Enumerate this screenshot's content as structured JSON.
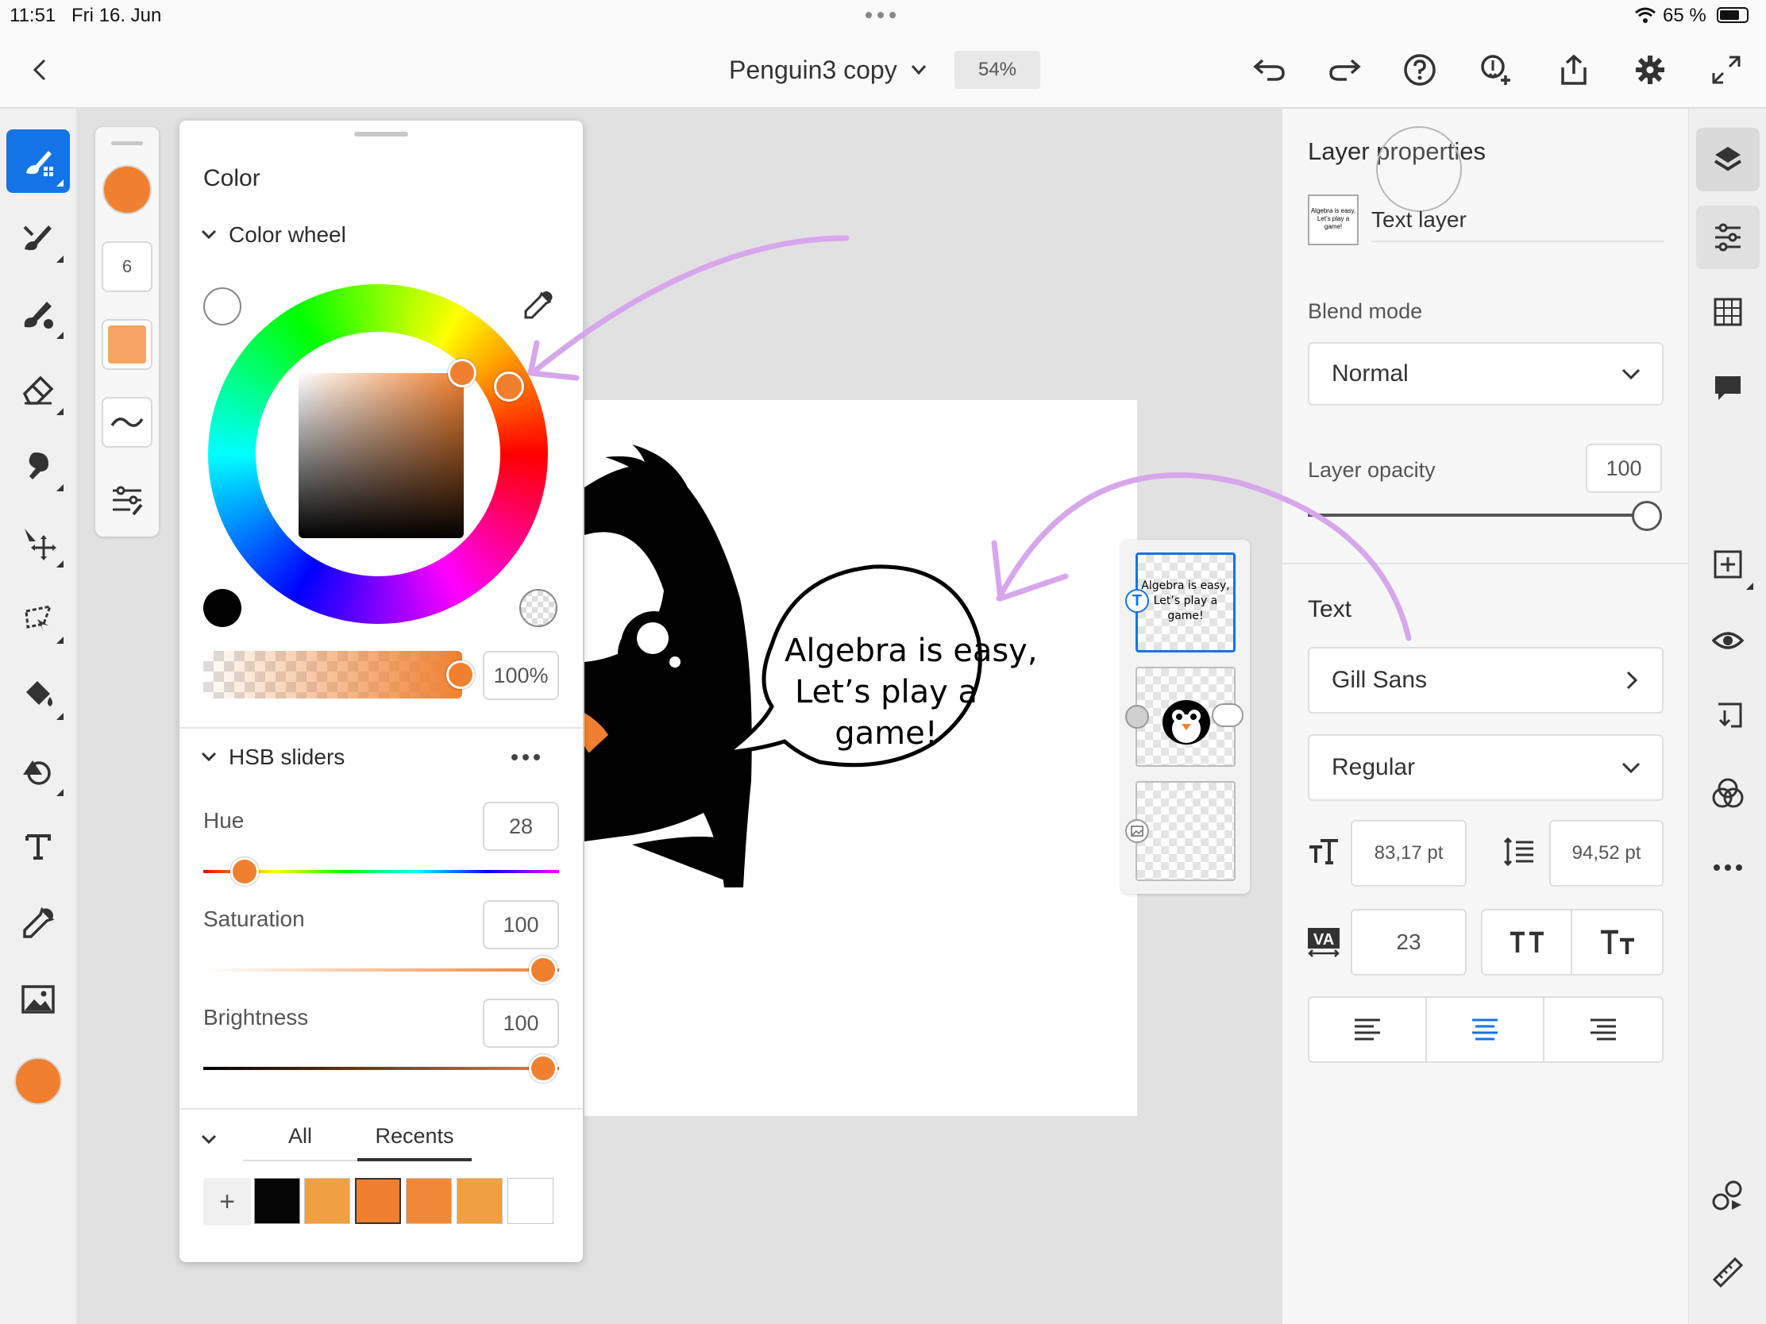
{
  "status": {
    "time": "11:51",
    "date": "Fri 16. Jun",
    "battery": "65 %"
  },
  "document": {
    "title": "Penguin3 copy",
    "zoom": "54%"
  },
  "brush": {
    "size": "6"
  },
  "color_panel": {
    "title": "Color",
    "wheel_section": "Color wheel",
    "opacity": "100%",
    "hsb_section": "HSB sliders",
    "hue_label": "Hue",
    "hue_value": "28",
    "saturation_label": "Saturation",
    "saturation_value": "100",
    "brightness_label": "Brightness",
    "brightness_value": "100",
    "tabs": [
      "All",
      "Recents"
    ],
    "add_label": "+",
    "swatches": [
      "#050505",
      "#f0a040",
      "#f08030",
      "#f08838",
      "#f0a040",
      "#ffffff"
    ],
    "current_color": "#f08030"
  },
  "canvas": {
    "speech_lines": [
      "Algebra is easy,",
      "Let’s play a",
      "game!"
    ]
  },
  "layer_thumb": {
    "text": "Algebra is easy, Let’s play a game!"
  },
  "layer_properties": {
    "title": "Layer properties",
    "layer_name": "Text layer",
    "thumb_text": "Algebra is easy, Let’s play a game!",
    "blend_label": "Blend mode",
    "blend_value": "Normal",
    "opacity_label": "Layer opacity",
    "opacity_value": "100",
    "text_section": "Text",
    "font": "Gill Sans",
    "style": "Regular",
    "font_size": "83,17 pt",
    "leading": "94,52 pt",
    "tracking": "23"
  },
  "accent": "#1473e6"
}
